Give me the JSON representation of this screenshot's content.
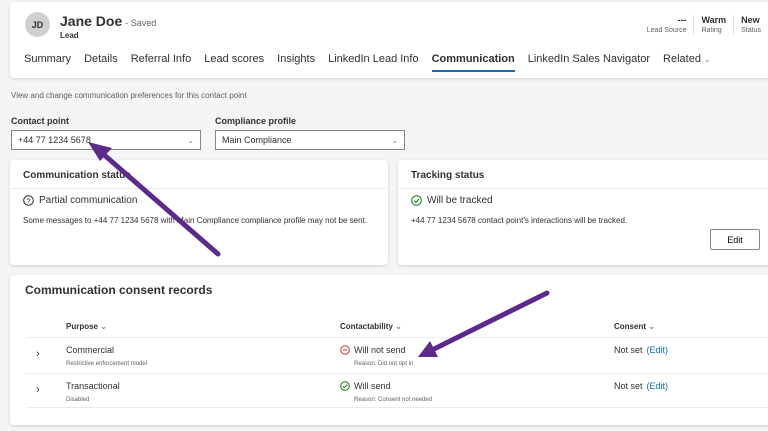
{
  "header": {
    "initials": "JD",
    "name": "Jane Doe",
    "saved": "- Saved",
    "entity": "Lead",
    "stats": [
      {
        "value": "---",
        "label": "Lead Source"
      },
      {
        "value": "Warm",
        "label": "Rating"
      },
      {
        "value": "New",
        "label": "Status"
      }
    ],
    "tabs": [
      "Summary",
      "Details",
      "Referral Info",
      "Lead scores",
      "Insights",
      "LinkedIn Lead Info",
      "Communication",
      "LinkedIn Sales Navigator",
      "Related"
    ]
  },
  "description": "View and change communication preferences for this contact point",
  "contact_point": {
    "label": "Contact point",
    "value": "+44 77 1234 5678"
  },
  "compliance_profile": {
    "label": "Compliance profile",
    "value": "Main Compliance"
  },
  "communication_status": {
    "title": "Communication status",
    "status": "Partial communication",
    "text": "Some messages to +44 77 1234 5678 with Main Compliance compliance profile may not be sent."
  },
  "tracking_status": {
    "title": "Tracking status",
    "status": "Will be tracked",
    "text": "+44 77 1234 5678 contact point's interactions will be tracked.",
    "edit": "Edit"
  },
  "consent": {
    "title": "Communication consent records",
    "columns": [
      "Purpose",
      "Contactability",
      "Consent"
    ],
    "rows": [
      {
        "purpose": "Commercial",
        "purpose_sub": "Restrictive enforcement model",
        "contact": "Will not send",
        "reason": "Reason: Did not opt in",
        "consent": "Not set",
        "edit": "(Edit)"
      },
      {
        "purpose": "Transactional",
        "purpose_sub": "Disabled",
        "contact": "Will send",
        "reason": "Reason: Consent not needed",
        "consent": "Not set",
        "edit": "(Edit)"
      }
    ]
  },
  "colors": {
    "accent": "#0f6cbd",
    "annotation": "#5b2a8c",
    "error": "#d13438",
    "success": "#107c10"
  }
}
